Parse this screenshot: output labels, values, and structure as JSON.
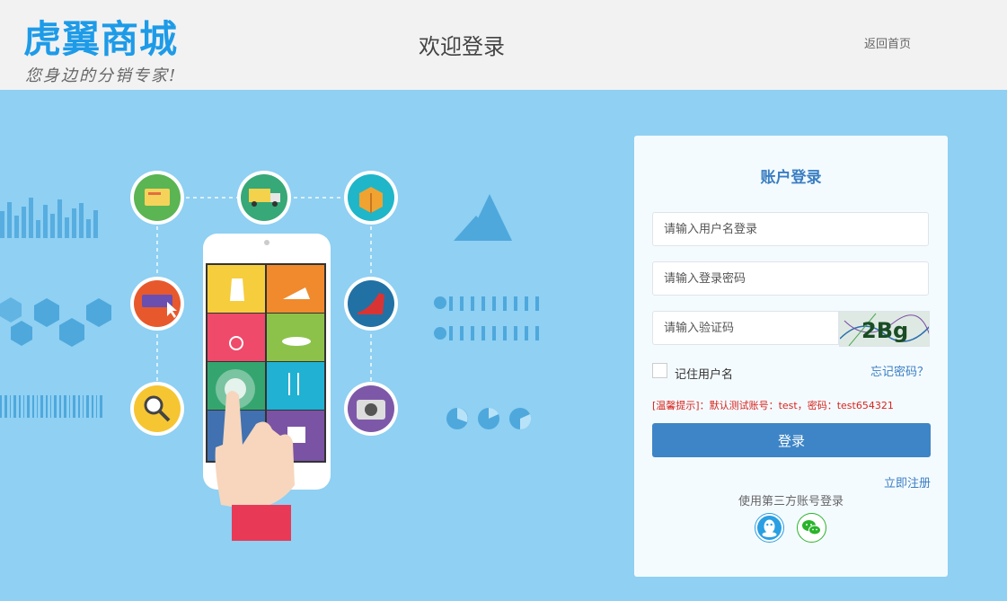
{
  "header": {
    "logo_text": "虎翼商城",
    "slogan": "您身边的分销专家!",
    "page_title": "欢迎登录",
    "home_link": "返回首页"
  },
  "login": {
    "title": "账户登录",
    "username_placeholder": "请输入用户名登录",
    "password_placeholder": "请输入登录密码",
    "captcha_placeholder": "请输入验证码",
    "captcha_text": "2Bg",
    "remember_label": "记住用户名",
    "forgot_link": "忘记密码？",
    "tip": "[温馨提示]：默认测试账号：test，密码：test654321",
    "login_button": "登录",
    "register_link": "立即注册",
    "third_party_label": "使用第三方账号登录"
  },
  "colors": {
    "header_bg": "#f2f2f2",
    "background": "#8fd0f3",
    "brand_blue": "#1d9be8",
    "primary_button": "#3d85c6",
    "link": "#3a7ec2",
    "tip_red": "#d9251d"
  },
  "icons": {
    "left_illustration": [
      "credit-card-icon",
      "delivery-truck-icon",
      "gift-box-icon",
      "card-payment-icon",
      "high-heel-icon",
      "magnifier-icon",
      "camera-icon",
      "dress-icon",
      "shoe-icon",
      "ring-icon",
      "hat-icon",
      "cutlery-icon",
      "present-icon"
    ],
    "social": [
      "qq-icon",
      "wechat-icon"
    ]
  }
}
